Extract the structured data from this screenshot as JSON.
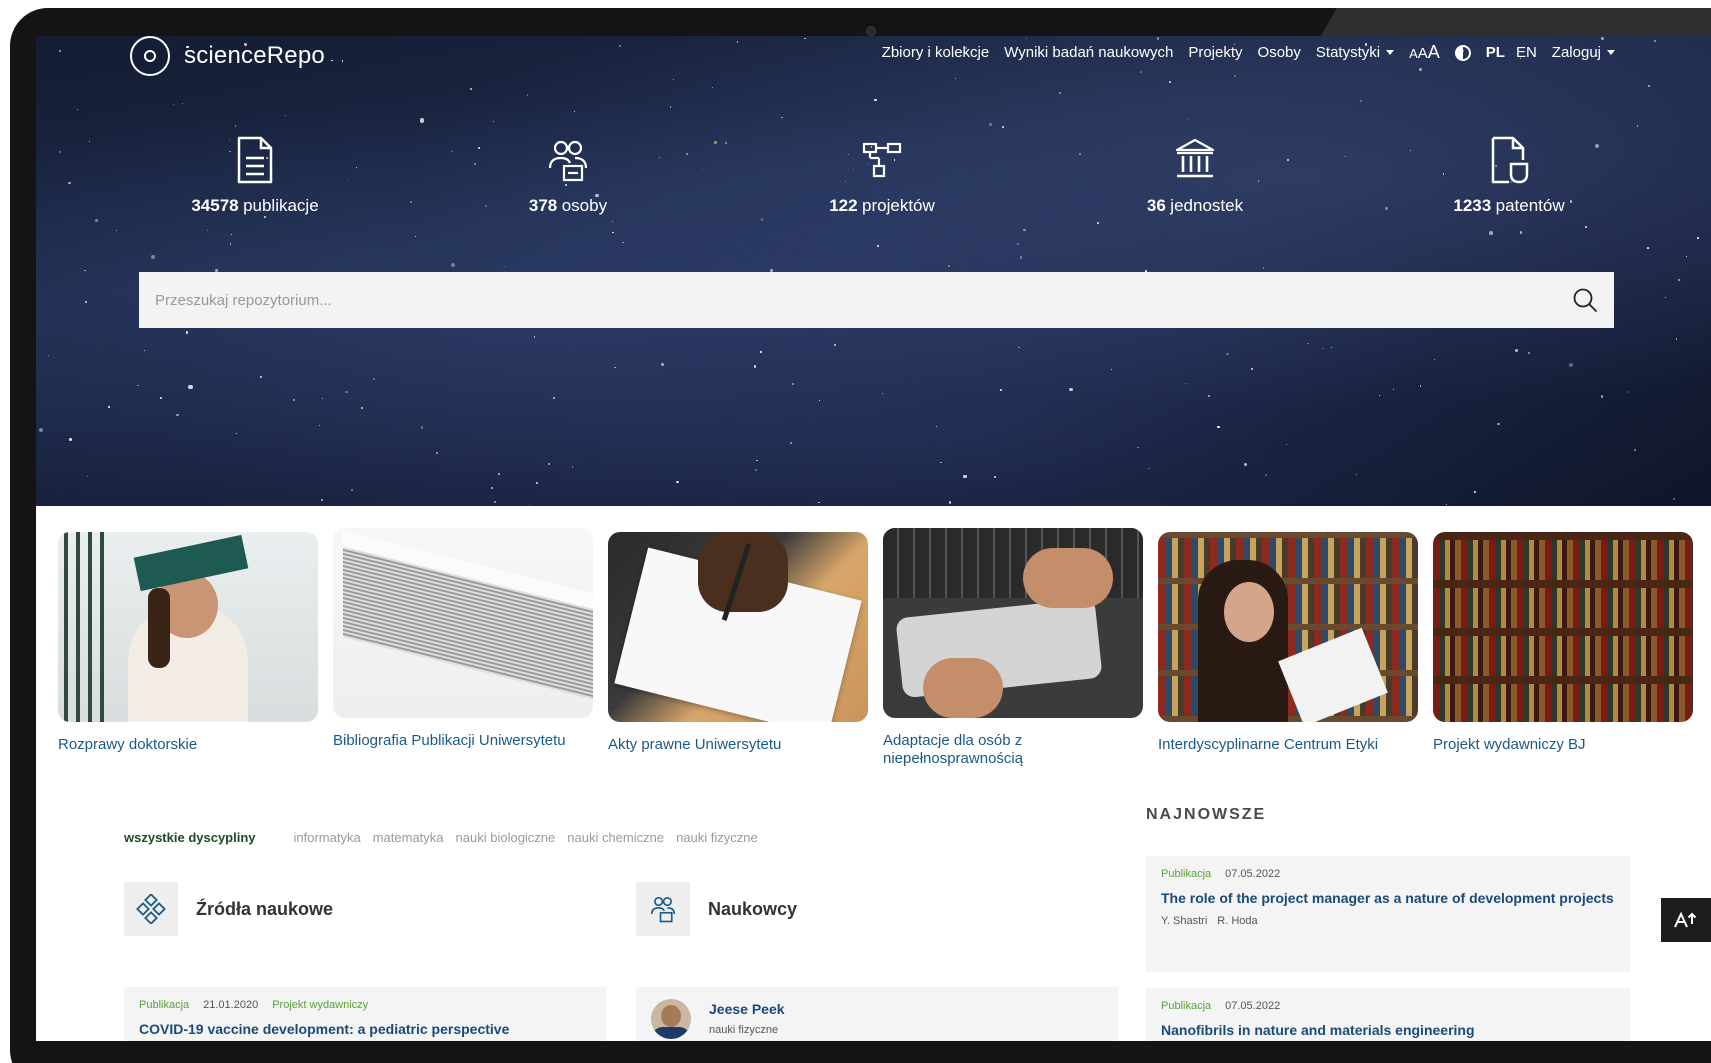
{
  "header": {
    "logo_text": "scienceRepo",
    "nav": [
      "Zbiory i kolekcje",
      "Wyniki badań naukowych",
      "Projekty",
      "Osoby",
      "Statystyki"
    ],
    "font_size_control": {
      "small": "A",
      "medium": "A",
      "large": "A"
    },
    "lang_active": "PL",
    "lang_other": "EN",
    "login": "Zaloguj"
  },
  "stats": [
    {
      "icon": "document-icon",
      "num": "34578",
      "label": "publikacje"
    },
    {
      "icon": "people-icon",
      "num": "378",
      "label": "osoby"
    },
    {
      "icon": "project-tree-icon",
      "num": "122",
      "label": "projektów"
    },
    {
      "icon": "institution-icon",
      "num": "36",
      "label": "jednostek"
    },
    {
      "icon": "patent-document-icon",
      "num": "1233",
      "label": "patentów"
    }
  ],
  "search": {
    "placeholder": "Przeszukaj repozytorium..."
  },
  "collections": [
    "Rozprawy doktorskie",
    "Bibliografia Publikacji Uniwersytetu",
    "Akty prawne Uniwersytetu",
    "Adaptacje dla osób z niepełnosprawnością",
    "Interdyscyplinarne Centrum Etyki",
    "Projekt wydawniczy BJ"
  ],
  "disciplines": {
    "active": "wszystkie dyscypliny",
    "items": [
      "informatyka",
      "matematyka",
      "nauki biologiczne",
      "nauki chemiczne",
      "nauki fizyczne"
    ]
  },
  "sources": {
    "title": "Źródła naukowe",
    "item": {
      "type": "Publikacja",
      "date": "21.01.2020",
      "tag": "Projekt wydawniczy",
      "title": "COVID-19 vaccine development: a pediatric perspective"
    }
  },
  "scientists": {
    "title": "Naukowcy",
    "item": {
      "name": "Jeese Peek",
      "discipline": "nauki fizyczne"
    }
  },
  "newest": {
    "title": "NAJNOWSZE",
    "items": [
      {
        "type": "Publikacja",
        "date": "07.05.2022",
        "title": "The role of the project manager as a nature of development projects",
        "authors": [
          "Y. Shastri",
          "R. Hoda"
        ]
      },
      {
        "type": "Publikacja",
        "date": "07.05.2022",
        "title": "Nanofibrils in nature and materials engineering"
      }
    ]
  },
  "colors": {
    "hero_bg": "#1d2a4a",
    "link": "#1a5a8a",
    "type_green": "#5ba03a",
    "discipline_active": "#1e4a2a"
  }
}
